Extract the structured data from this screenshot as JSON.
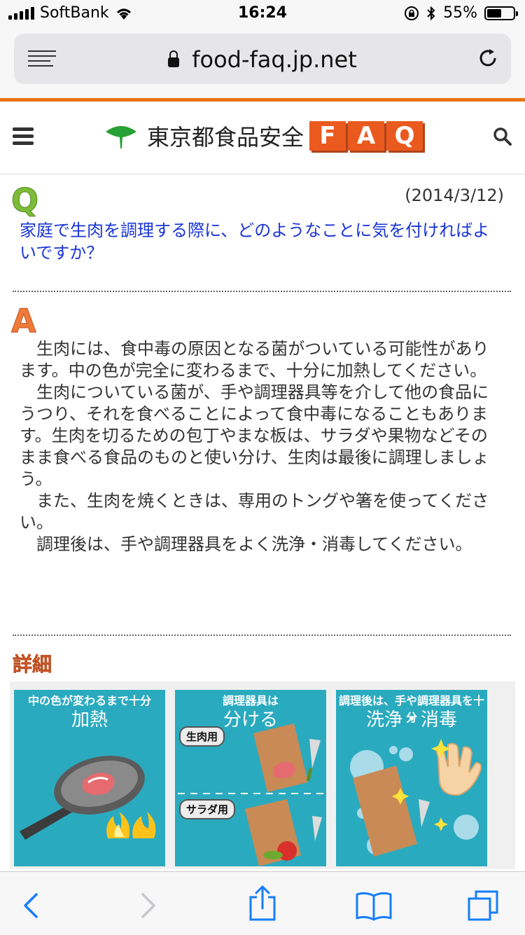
{
  "status_bar": {
    "carrier": "SoftBank",
    "time": "16:24",
    "battery_percent": "55%",
    "battery_level": 0.55
  },
  "browser": {
    "url": "food-faq.jp.net"
  },
  "site": {
    "logo_text": "東京都食品安全",
    "faq_letters": [
      "F",
      "A",
      "Q"
    ]
  },
  "qa": {
    "q_mark": "Q",
    "date": "(2014/3/12)",
    "question": "家庭で生肉を調理する際に、どのようなことに気を付ければよいですか？",
    "a_mark": "A",
    "answer_paragraphs": [
      "生肉には、食中毒の原因となる菌がついている可能性があります。中の色が完全に変わるまで、十分に加熱してください。",
      "生肉についている菌が、手や調理器具等を介して他の食品にうつり、それを食べることによって食中毒になることもあります。生肉を切るための包丁やまな板は、サラダや果物などそのまま食べる食品のものと使い分け、生肉は最後に調理しましょう。",
      "また、生肉を焼くときは、専用のトングや箸を使ってください。",
      "調理後は、手や調理器具をよく洗浄・消毒してください。"
    ],
    "detail_label": "詳細"
  },
  "panels": [
    {
      "caption_small": "中の色が変わるまで十分",
      "caption_large": "加熱"
    },
    {
      "caption_small": "調理器具は",
      "caption_large": "分ける",
      "tag_top": "生肉用",
      "tag_bottom": "サラダ用"
    },
    {
      "caption_small": "調理後は、手や調理器具を十分",
      "caption_large": "洗浄・消毒"
    }
  ],
  "colors": {
    "accent_orange": "#e8730d",
    "question_blue": "#1a35d6",
    "panel_teal": "#2aaabf",
    "ios_blue": "#157efb"
  }
}
